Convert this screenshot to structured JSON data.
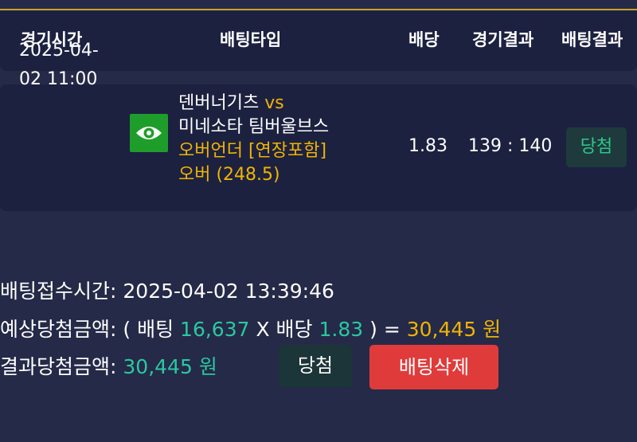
{
  "header": {
    "col_time": "경기시간",
    "col_bet_type": "배팅타입",
    "col_odds": "배당",
    "col_game_result": "경기결과",
    "col_bet_result": "배팅결과"
  },
  "bet": {
    "time_line1": "2025-04-",
    "time_line2": "02 11:00",
    "icon": "eye-icon",
    "home_team": "덴버너기츠",
    "vs": "vs",
    "away_team": "미네소타 팀버울브스",
    "market": "오버언더 [연장포함]",
    "pick": "오버 (248.5)",
    "odds": "1.83",
    "score": "139 : 140",
    "result": "당첨"
  },
  "summary": {
    "received_label": "배팅접수시간",
    "received_value": "2025-04-02 13:39:46",
    "expected_label": "예상당첨금액",
    "open_paren": "( 배팅",
    "stake": "16,637",
    "x_odds_label": "X 배당",
    "odds": "1.83",
    "close_paren": ") =",
    "expected_amount": "30,445 원",
    "actual_label": "결과당첨금액",
    "actual_amount": "30,445 원"
  },
  "buttons": {
    "win_label": "당첨",
    "delete_label": "배팅삭제"
  },
  "colors": {
    "background": "#252a48",
    "panel": "#1c2140",
    "accent_gold": "#f0b400",
    "accent_teal": "#2cc7a0",
    "delete_red": "#e03b3b"
  }
}
